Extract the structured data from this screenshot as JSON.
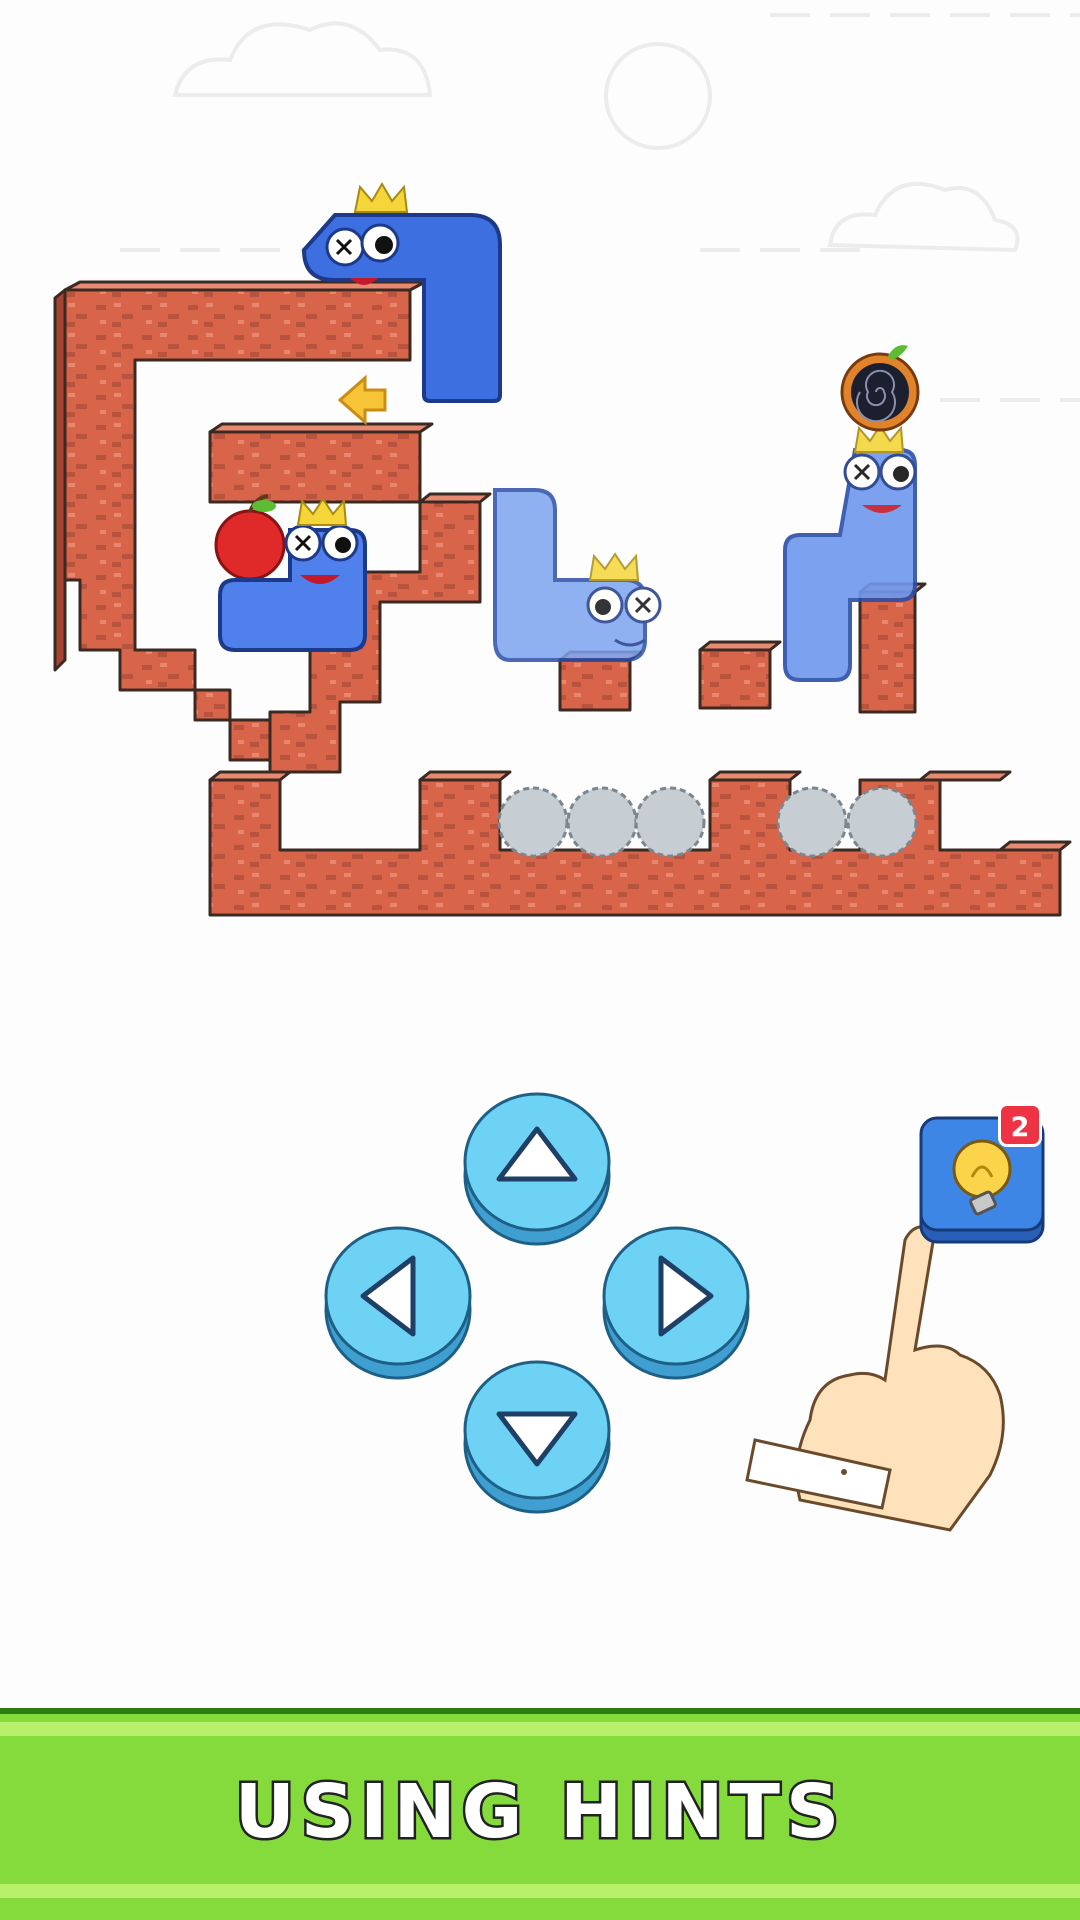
{
  "controls": {
    "dpad": {
      "up": "arrow-up-icon",
      "left": "arrow-left-icon",
      "right": "arrow-right-icon",
      "down": "arrow-down-icon"
    },
    "hint": {
      "icon": "lightbulb-icon",
      "count": "2"
    }
  },
  "banner": {
    "title": "USING HINTS"
  },
  "colors": {
    "brick": "#d8644a",
    "brick_dark": "#a84532",
    "worm_blue": "#5b8ff0",
    "worm_dark": "#2b5fd8",
    "dpad_blue": "#6ed2f5",
    "banner_green": "#86db3c",
    "hint_blue": "#3d86e6",
    "badge_red": "#ee3344"
  }
}
